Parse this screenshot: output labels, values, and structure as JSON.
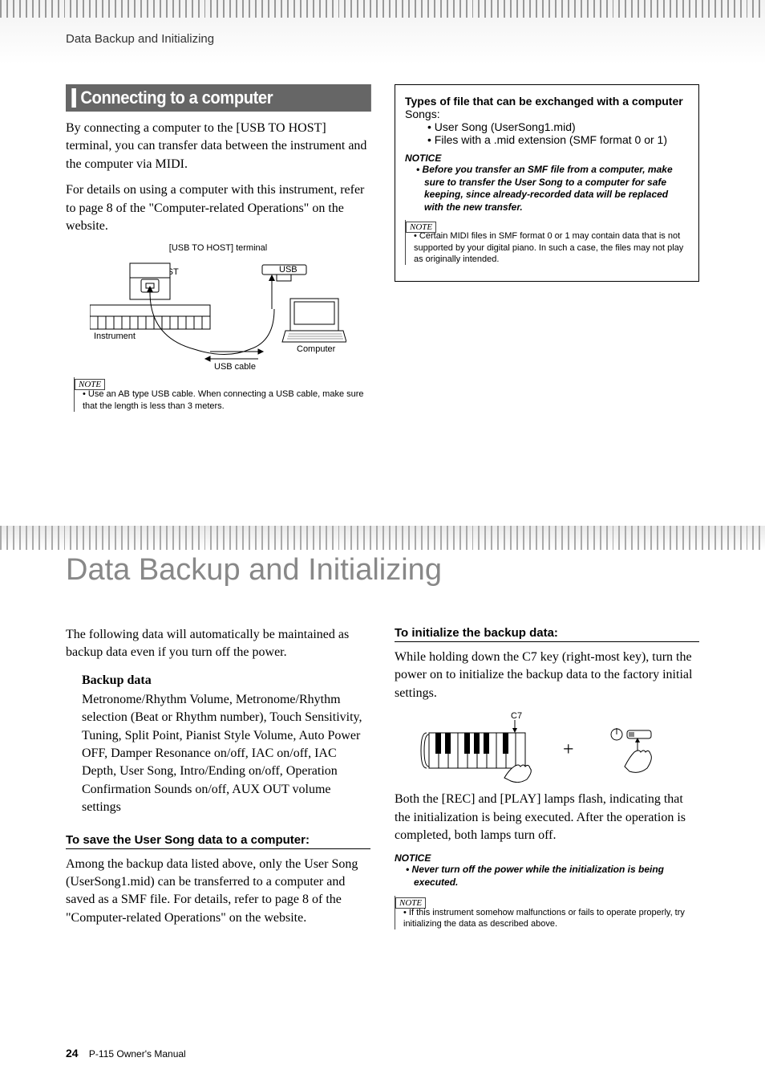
{
  "header": {
    "breadcrumb": "Data Backup and Initializing"
  },
  "section1": {
    "title": "Connecting to a computer",
    "p1": "By connecting a computer to the [USB TO HOST] terminal, you can transfer data between the instrument and the computer via MIDI.",
    "p2": "For details on using a computer with this instrument, refer to page 8 of the \"Computer-related Operations\" on the website.",
    "diag_caption": "[USB TO HOST] terminal",
    "diag_usb_to_host": "USB TO HOST",
    "diag_usb": "USB",
    "diag_instrument": "Instrument",
    "diag_computer": "Computer",
    "diag_cable": "USB cable",
    "note1_label": "NOTE",
    "note1_text": "• Use an AB type USB cable. When connecting a USB cable, make sure that the length is less than 3 meters."
  },
  "box": {
    "title": "Types of file that can be exchanged with a computer",
    "songs": "Songs:",
    "item1": "User Song (UserSong1.mid)",
    "item2": "Files with a .mid extension (SMF format 0 or 1)",
    "notice_label": "NOTICE",
    "notice_text": "• Before you transfer an SMF file from a computer, make sure to transfer the User Song to a computer for safe keeping, since already-recorded data will be replaced with the new transfer.",
    "note_label": "NOTE",
    "note_text": "• Certain MIDI files in SMF format 0 or 1 may contain data that is not supported by your digital piano. In such a case, the files may not play as originally intended."
  },
  "section2": {
    "title": "Data Backup and Initializing",
    "intro": "The following data will automatically be maintained as backup data even if you turn off the power.",
    "bd_heading": "Backup data",
    "bd_body": "Metronome/Rhythm Volume, Metronome/Rhythm selection (Beat or Rhythm number), Touch Sensitivity, Tuning, Split Point, Pianist Style Volume, Auto Power OFF, Damper Resonance on/off, IAC on/off, IAC Depth, User Song, Intro/Ending on/off, Operation Confirmation Sounds on/off, AUX OUT volume settings",
    "save_heading": "To save the User Song data to a computer:",
    "save_body": "Among the backup data listed above, only the User Song (UserSong1.mid) can be transferred to a computer and saved as a SMF file. For details, refer to page 8 of the \"Computer-related Operations\" on the website.",
    "init_heading": "To initialize the backup data:",
    "init_body1": "While holding down the C7 key (right-most key), turn the power on to initialize the backup data to the factory initial settings.",
    "c7_label": "C7",
    "init_body2": "Both the [REC] and [PLAY] lamps flash, indicating that the initialization is being executed. After the operation is completed, both lamps turn off.",
    "notice_label": "NOTICE",
    "notice_text": "• Never turn off the power while the initialization is being executed.",
    "note_label": "NOTE",
    "note_text": "• If this instrument somehow malfunctions or fails to operate properly, try initializing the data as described above."
  },
  "footer": {
    "page": "24",
    "doc": "P-115  Owner's Manual"
  }
}
